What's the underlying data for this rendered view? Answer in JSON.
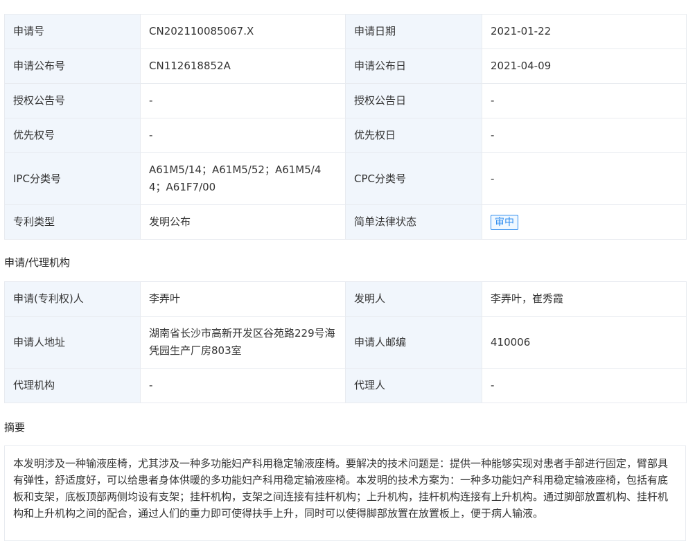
{
  "basic": [
    {
      "k1": "申请号",
      "v1": "CN202110085067.X",
      "k2": "申请日期",
      "v2": "2021-01-22"
    },
    {
      "k1": "申请公布号",
      "v1": "CN112618852A",
      "k2": "申请公布日",
      "v2": "2021-04-09"
    },
    {
      "k1": "授权公告号",
      "v1": "-",
      "k2": "授权公告日",
      "v2": "-"
    },
    {
      "k1": "优先权号",
      "v1": "-",
      "k2": "优先权日",
      "v2": "-"
    },
    {
      "k1": "IPC分类号",
      "v1": "A61M5/14；A61M5/52；A61M5/44；A61F7/00",
      "k2": "CPC分类号",
      "v2": "-"
    },
    {
      "k1": "专利类型",
      "v1": "发明公布",
      "k2": "简单法律状态",
      "v2": "审中"
    }
  ],
  "agency_title": "申请/代理机构",
  "agency": [
    {
      "k1": "申请(专利权)人",
      "v1": "李弄叶",
      "k2": "发明人",
      "v2": "李弄叶，崔秀霞"
    },
    {
      "k1": "申请人地址",
      "v1": "湖南省长沙市高新开发区谷苑路229号海凭园生产厂房803室",
      "k2": "申请人邮编",
      "v2": "410006"
    },
    {
      "k1": "代理机构",
      "v1": "-",
      "k2": "代理人",
      "v2": "-"
    }
  ],
  "abstract_title": "摘要",
  "abstract_text": "本发明涉及一种输液座椅，尤其涉及一种多功能妇产科用稳定输液座椅。要解决的技术问题是：提供一种能够实现对患者手部进行固定，臂部具有弹性，舒适度好，可以给患者身体供暖的多功能妇产科用稳定输液座椅。本发明的技术方案为：一种多功能妇产科用稳定输液座椅，包括有底板和支架，底板顶部两侧均设有支架；挂杆机构，支架之间连接有挂杆机构；上升机构，挂杆机构连接有上升机构。通过脚部放置机构、挂杆机构和上升机构之间的配合，通过人们的重力即可使得扶手上升，同时可以使得脚部放置在放置板上，便于病人输液。",
  "colors": {
    "key_bg": "#f1f6fc",
    "border": "#e8ebf0",
    "badge": "#2d8cf0"
  }
}
